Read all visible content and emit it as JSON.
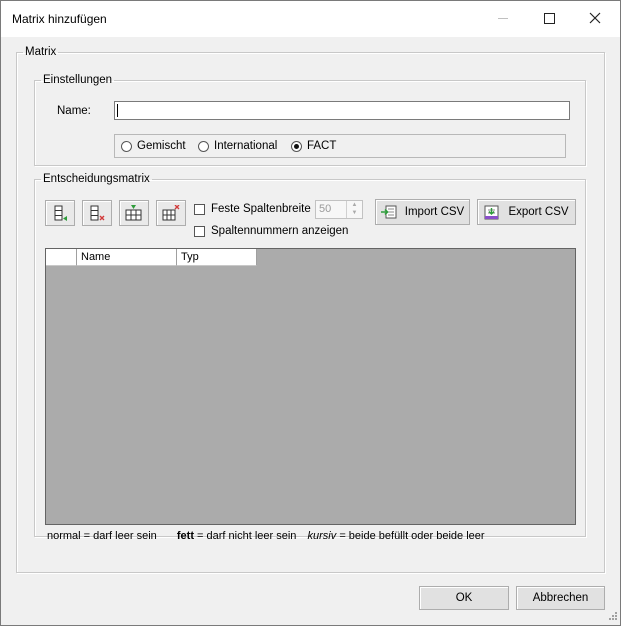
{
  "window": {
    "title": "Matrix hinzufügen"
  },
  "groups": {
    "matrix": "Matrix",
    "settings": "Einstellungen",
    "decision_matrix": "Entscheidungsmatrix"
  },
  "name_field": {
    "label": "Name:",
    "value": ""
  },
  "radio_options": [
    {
      "label": "Gemischt",
      "selected": false
    },
    {
      "label": "International",
      "selected": false
    },
    {
      "label": "FACT",
      "selected": true
    }
  ],
  "toolbar": {
    "fixed_width_label": "Feste Spaltenbreite",
    "fixed_width_checked": false,
    "column_width_value": "50",
    "show_column_numbers_label": "Spaltennummern anzeigen",
    "show_column_numbers_checked": false,
    "import_csv_label": "Import CSV",
    "export_csv_label": "Export CSV",
    "icon_buttons": [
      "add-column-icon",
      "remove-column-icon",
      "add-row-icon",
      "remove-row-icon"
    ]
  },
  "grid": {
    "columns": [
      "",
      "Name",
      "Typ"
    ]
  },
  "legend": {
    "normal_term": "normal",
    "normal_desc": " = darf leer sein",
    "bold_term": "fett",
    "bold_desc": " = darf nicht leer sein",
    "italic_term": "kursiv",
    "italic_desc": " = beide befüllt oder beide leer"
  },
  "buttons": {
    "ok": "OK",
    "cancel": "Abbrechen"
  },
  "colors": {
    "window_bg": "#f0f0f0",
    "grid_bg": "#ababab",
    "accent_green": "#2e9c3a",
    "accent_red": "#d23a3a"
  }
}
